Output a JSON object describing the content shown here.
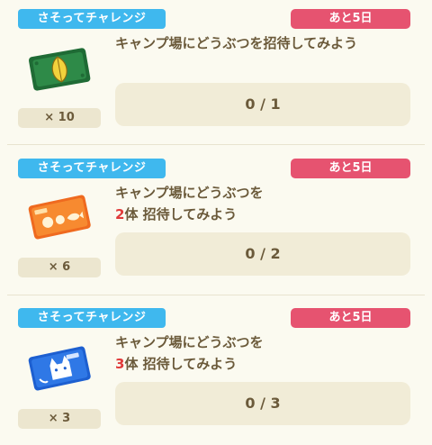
{
  "challenges": [
    {
      "tag": "さそってチャレンジ",
      "days_left": "あと5日",
      "title_line1": "キャンプ場にどうぶつを招待してみよう",
      "title_count": "",
      "title_line2": "",
      "progress": "0 / 1",
      "reward_icon": "leaf-ticket-icon",
      "reward_qty": "× 10"
    },
    {
      "tag": "さそってチャレンジ",
      "days_left": "あと5日",
      "title_line1": "キャンプ場にどうぶつを",
      "title_count": "2",
      "title_line2": "体 招待してみよう",
      "progress": "0 / 2",
      "reward_icon": "orange-fish-ticket-icon",
      "reward_qty": "× 6"
    },
    {
      "tag": "さそってチャレンジ",
      "days_left": "あと5日",
      "title_line1": "キャンプ場にどうぶつを",
      "title_count": "3",
      "title_line2": "体 招待してみよう",
      "progress": "0 / 3",
      "reward_icon": "blue-cat-ticket-icon",
      "reward_qty": "× 3"
    }
  ],
  "colors": {
    "challenge_tag": "#3fb8ee",
    "days_tag": "#e65370",
    "highlight_number": "#e03a3a",
    "text": "#6b5a3a",
    "progress_bg": "#f1ecd7",
    "background": "#fbfaf0"
  }
}
